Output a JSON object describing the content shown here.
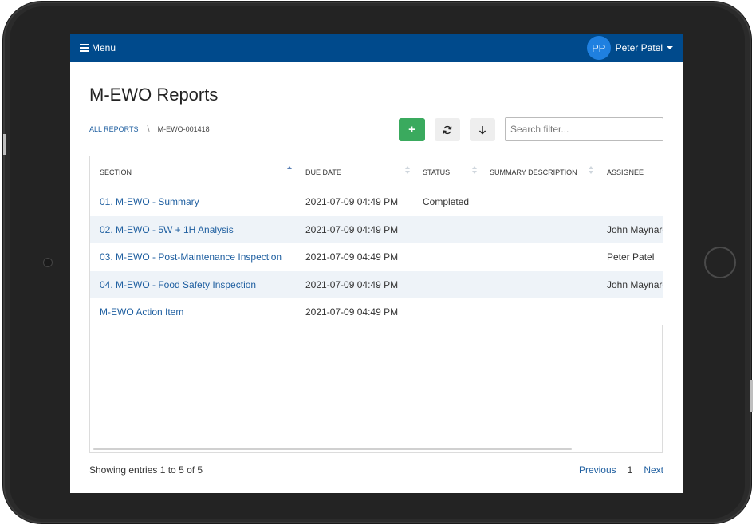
{
  "topbar": {
    "menu_label": "Menu",
    "avatar_initials": "PP",
    "user_name": "Peter Patel"
  },
  "page": {
    "title": "M-EWO Reports"
  },
  "breadcrumb": {
    "parent": "ALL REPORTS",
    "current": "M-EWO-001418"
  },
  "toolbar": {
    "add_label": "+",
    "search_placeholder": "Search filter..."
  },
  "table": {
    "headers": {
      "section": "SECTION",
      "due_date": "DUE DATE",
      "status": "STATUS",
      "summary": "SUMMARY DESCRIPTION",
      "assignee": "ASSIGNEE"
    },
    "rows": [
      {
        "section": "01. M-EWO - Summary",
        "due_date": "2021-07-09 04:49 PM",
        "status": "Completed",
        "summary": "",
        "assignee": ""
      },
      {
        "section": "02. M-EWO - 5W + 1H Analysis",
        "due_date": "2021-07-09 04:49 PM",
        "status": "",
        "summary": "",
        "assignee": "John Maynard"
      },
      {
        "section": "03. M-EWO - Post-Maintenance Inspection",
        "due_date": "2021-07-09 04:49 PM",
        "status": "",
        "summary": "",
        "assignee": "Peter Patel"
      },
      {
        "section": "04. M-EWO - Food Safety Inspection",
        "due_date": "2021-07-09 04:49 PM",
        "status": "",
        "summary": "",
        "assignee": "John Maynard"
      },
      {
        "section": "M-EWO Action Item",
        "due_date": "2021-07-09 04:49 PM",
        "status": "",
        "summary": "",
        "assignee": ""
      }
    ]
  },
  "footer": {
    "info": "Showing entries 1 to 5 of 5",
    "previous": "Previous",
    "page": "1",
    "next": "Next"
  },
  "colors": {
    "topbar": "#004a8c",
    "link": "#1f5fa0",
    "add_button": "#3aaa5e",
    "row_stripe": "#eef3f8"
  }
}
